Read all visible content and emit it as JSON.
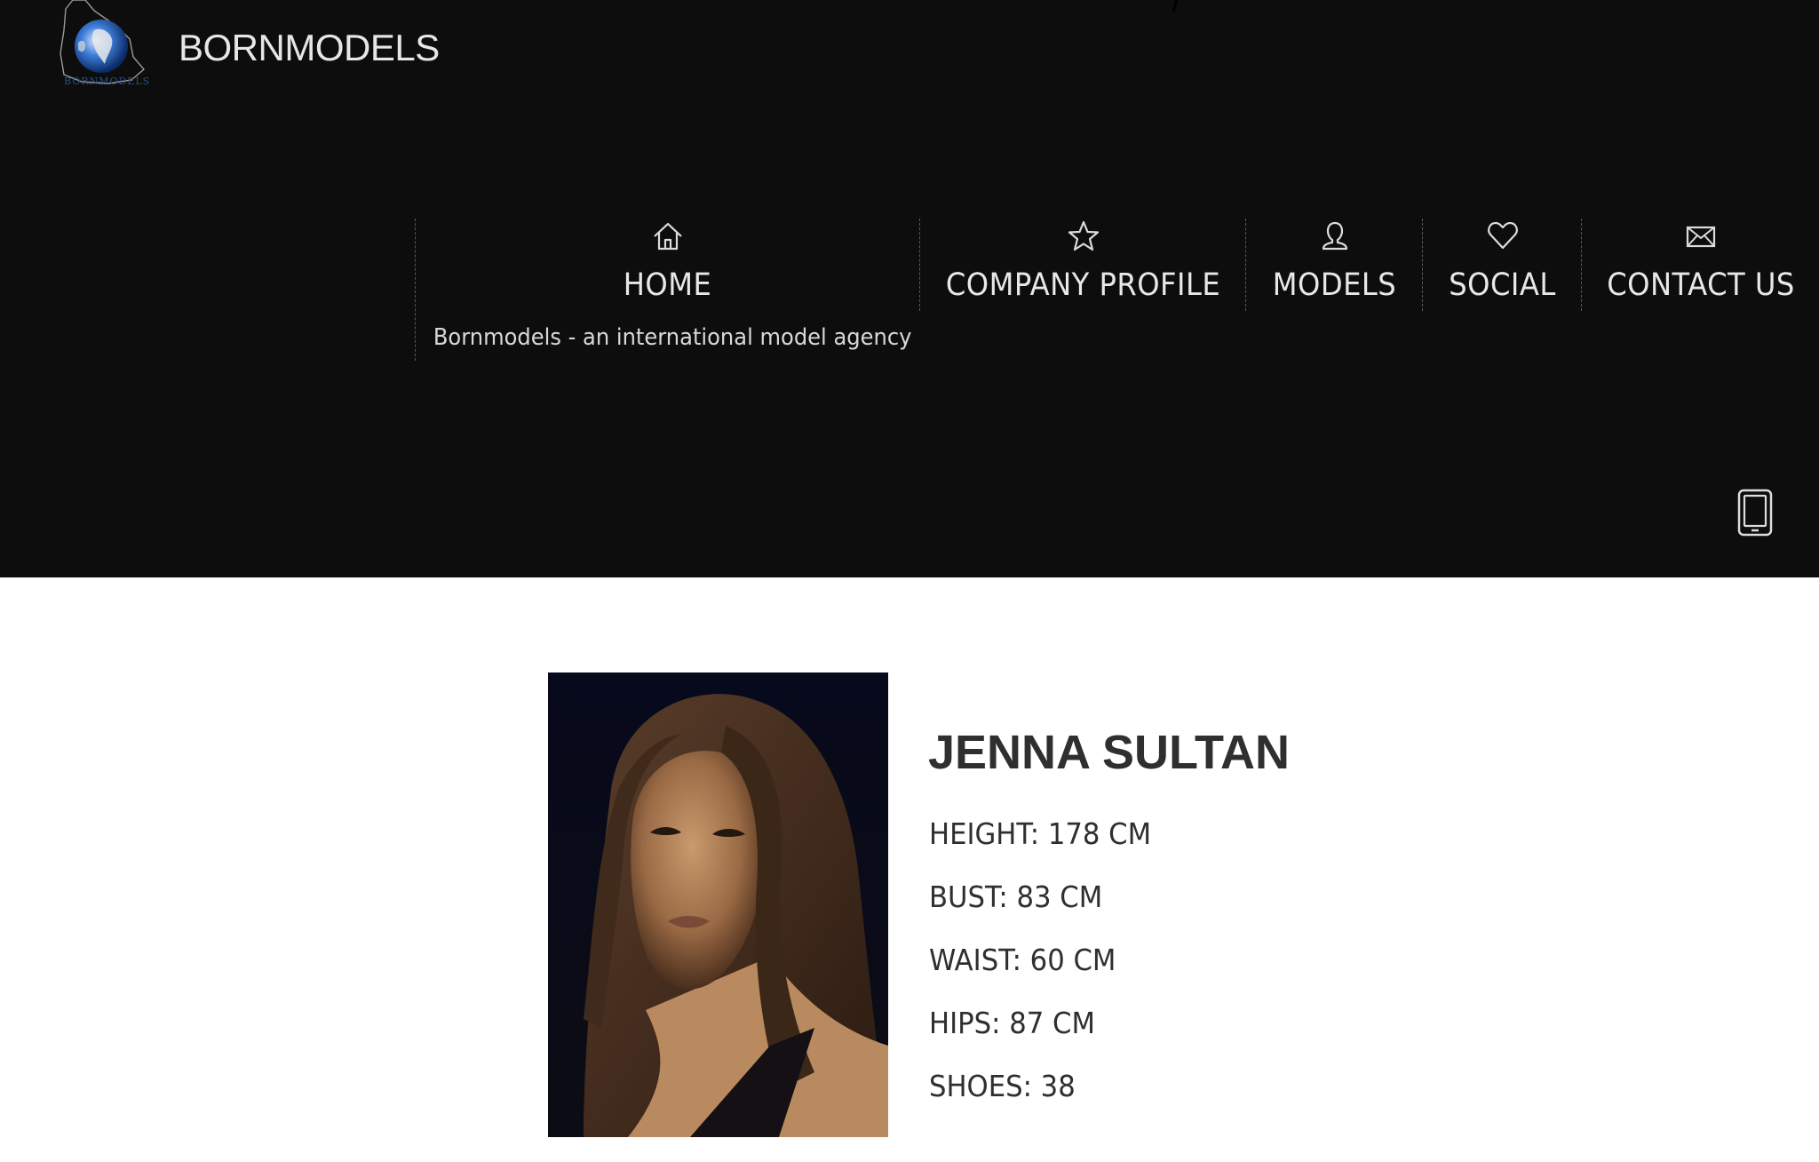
{
  "header": {
    "brand": "BORNMODELS",
    "logo_caption": "BORNMODELS"
  },
  "nav": {
    "items": [
      {
        "label": "HOME",
        "icon": "home-icon"
      },
      {
        "label": "COMPANY PROFILE",
        "icon": "star-icon"
      },
      {
        "label": "MODELS",
        "icon": "user-icon"
      },
      {
        "label": "SOCIAL",
        "icon": "heart-icon"
      },
      {
        "label": "CONTACT US",
        "icon": "envelope-icon"
      }
    ],
    "tagline": "Bornmodels - an international model agency"
  },
  "mobile_icon": "mobile-phone-icon",
  "model": {
    "name": "JENNA SULTAN",
    "stats": [
      "HEIGHT: 178 CM",
      "BUST: 83 CM",
      "WAIST: 60 CM",
      "HIPS: 87 CM",
      "SHOES: 38"
    ]
  },
  "colors": {
    "header_bg": "#0d0d0d",
    "nav_text": "#e8e8e8",
    "body_text": "#2f2f2f",
    "page_bg": "#ffffff"
  }
}
